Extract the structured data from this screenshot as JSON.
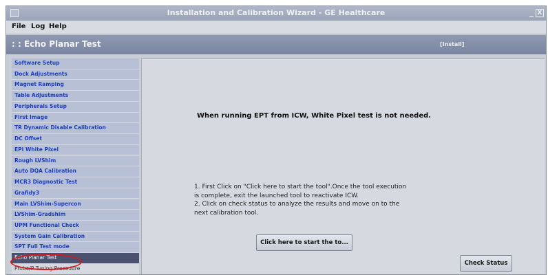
{
  "window": {
    "title": "Installation and Calibration Wizard - GE Healthcare",
    "minimize_label": "_",
    "close_label": "X"
  },
  "menu": {
    "items": [
      "File",
      "Log",
      "Help"
    ]
  },
  "section": {
    "title": ": : Echo Planar Test",
    "tag": "[Install]"
  },
  "sidebar": {
    "items": [
      {
        "label": "Software Setup",
        "state": "normal"
      },
      {
        "label": "Dock Adjustments",
        "state": "normal"
      },
      {
        "label": "Magnet Ramping",
        "state": "normal"
      },
      {
        "label": "Table Adjustments",
        "state": "normal"
      },
      {
        "label": "Peripherals Setup",
        "state": "normal"
      },
      {
        "label": "First Image",
        "state": "normal"
      },
      {
        "label": "TR Dynamic Disable Calibration",
        "state": "normal"
      },
      {
        "label": "DC Offset",
        "state": "normal"
      },
      {
        "label": "EPI White Pixel",
        "state": "normal"
      },
      {
        "label": "Rough LVShim",
        "state": "normal"
      },
      {
        "label": "Auto DQA Calibration",
        "state": "normal"
      },
      {
        "label": "MCR3 Diagnostic Test",
        "state": "normal"
      },
      {
        "label": "Grafidy3",
        "state": "normal"
      },
      {
        "label": "Main LVShim-Supercon",
        "state": "normal"
      },
      {
        "label": "LVShim-Gradshim",
        "state": "normal"
      },
      {
        "label": "UPM Functional Check",
        "state": "normal"
      },
      {
        "label": "System Gain Calibration",
        "state": "normal"
      },
      {
        "label": "SPT Full Test mode",
        "state": "normal"
      },
      {
        "label": "Echo Planar Test",
        "state": "active"
      },
      {
        "label": "Probe/P Tuning Procedure",
        "state": "next"
      }
    ]
  },
  "main": {
    "notice": "When running EPT from ICW, White Pixel test is not needed.",
    "instructions": [
      "1. First Click on \"Click here to start the tool\".Once the tool execution\nis complete, exit the launched tool to reactivate ICW.",
      "2. Click on check status to analyze the results and move on to the\nnext calibration tool."
    ],
    "start_button_label": "Click here to start the to...",
    "check_status_label": "Check Status"
  },
  "colors": {
    "sidebar_link": "#1c3fc0",
    "active_item_bg": "#4a5270",
    "highlight_ring": "#d11a1a"
  }
}
